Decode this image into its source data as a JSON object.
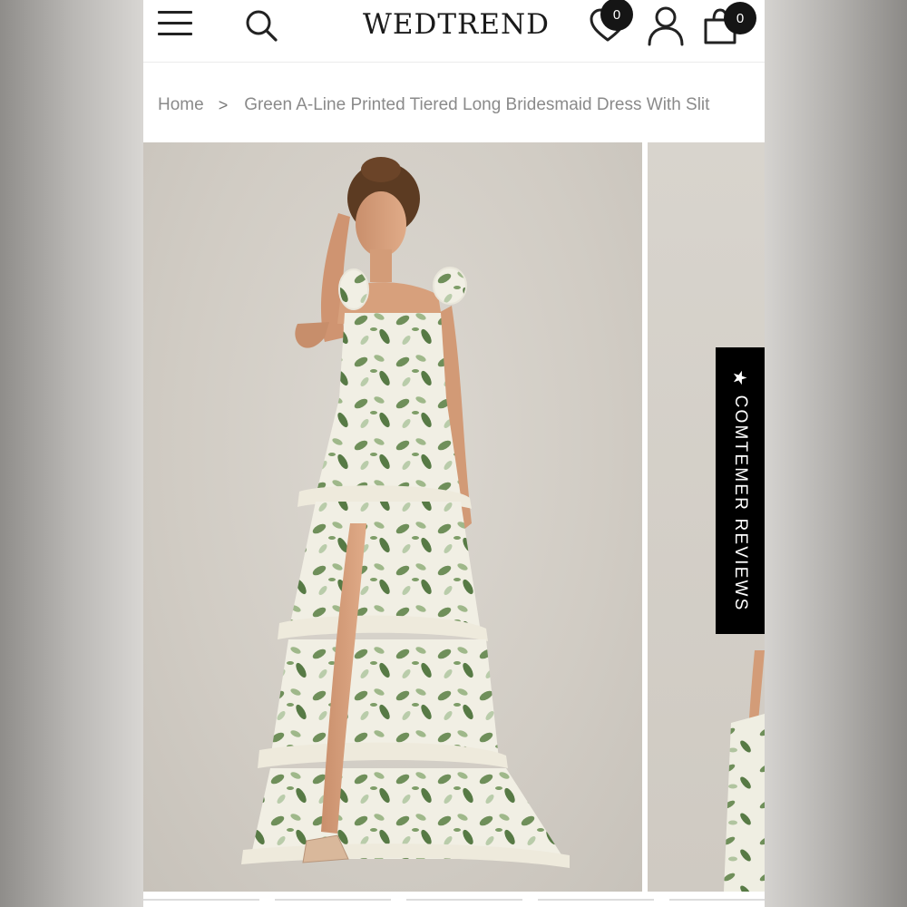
{
  "header": {
    "logo_text": "WEDTREND",
    "wishlist_count": "0",
    "cart_count": "0",
    "icons": [
      "hamburger-menu-icon",
      "search-icon",
      "heart-icon",
      "user-icon",
      "shopping-bag-icon"
    ]
  },
  "breadcrumb": {
    "home": "Home",
    "separator": ">",
    "current": "Green A-Line Printed Tiered Long Bridesmaid Dress With Slit"
  },
  "gallery": {
    "main_image": "model-in-green-floral-tiered-dress",
    "next_image": "dress-detail-preview"
  },
  "reviews_tab": {
    "star": "★",
    "label": "COMTEMER REVIEWS"
  },
  "colors": {
    "accent_black": "#000000",
    "badge": "#151515",
    "breadcrumb_text": "#8a8a8a",
    "dress_green": "#6f8f5a"
  }
}
